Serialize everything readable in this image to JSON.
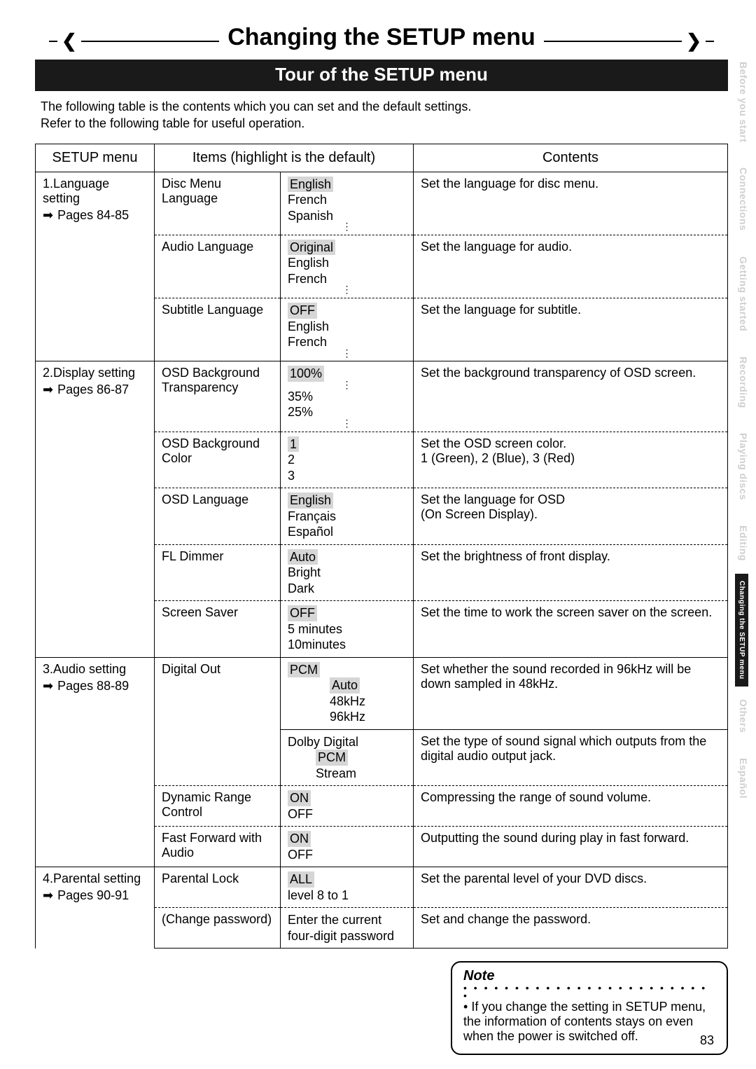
{
  "title": "Changing the SETUP menu",
  "subtitle": "Tour of the SETUP menu",
  "intro1": "The following table is the contents which you can set and the default settings.",
  "intro2": "Refer to the following table for useful operation.",
  "headers": {
    "menu": "SETUP menu",
    "items": "Items (highlight is the default)",
    "contents": "Contents"
  },
  "sections": [
    {
      "label": "1.Language setting",
      "pages": "Pages 84-85"
    },
    {
      "label": "2.Display setting",
      "pages": "Pages 86-87"
    },
    {
      "label": "3.Audio setting",
      "pages": "Pages 88-89"
    },
    {
      "label": "4.Parental setting",
      "pages": "Pages 90-91"
    }
  ],
  "rows": {
    "disc_menu_lang": {
      "item": "Disc Menu Language",
      "opts": [
        "English",
        "French",
        "Spanish"
      ],
      "desc": "Set the language for disc menu."
    },
    "audio_lang": {
      "item": "Audio Language",
      "opts": [
        "Original",
        "English",
        "French"
      ],
      "desc": "Set the language for audio."
    },
    "sub_lang": {
      "item": "Subtitle Language",
      "opts": [
        "OFF",
        "English",
        "French"
      ],
      "desc": "Set the language for subtitle."
    },
    "osd_trans": {
      "item": "OSD Background Transparency",
      "opts": [
        "100%",
        "35%",
        "25%"
      ],
      "desc": "Set the background transparency of OSD screen."
    },
    "osd_color": {
      "item": "OSD Background Color",
      "opts": [
        "1",
        "2",
        "3"
      ],
      "desc1": "Set the OSD screen color.",
      "desc2": "1 (Green), 2 (Blue), 3 (Red)"
    },
    "osd_lang": {
      "item": "OSD Language",
      "opts": [
        "English",
        "Français",
        "Español"
      ],
      "desc1": "Set the language for OSD",
      "desc2": "(On Screen Display)."
    },
    "fl_dimmer": {
      "item": "FL Dimmer",
      "opts": [
        "Auto",
        "Bright",
        "Dark"
      ],
      "desc": "Set the brightness of front display."
    },
    "screen_saver": {
      "item": "Screen Saver",
      "opts": [
        "OFF",
        "5 minutes",
        "10minutes"
      ],
      "desc": "Set the time to work the screen saver on the screen."
    },
    "digital_out_a": {
      "item": "Digital Out",
      "head": "PCM",
      "opts": [
        "Auto",
        "48kHz",
        "96kHz"
      ],
      "desc": "Set whether the sound recorded in 96kHz will be down sampled in 48kHz."
    },
    "digital_out_b": {
      "head": "Dolby Digital",
      "opts": [
        "PCM",
        "Stream"
      ],
      "desc": "Set the type of sound signal which outputs from the digital audio output jack."
    },
    "drc": {
      "item": "Dynamic Range Control",
      "opts": [
        "ON",
        "OFF"
      ],
      "desc": "Compressing the range of sound volume."
    },
    "ff_audio": {
      "item": "Fast Forward with Audio",
      "opts": [
        "ON",
        "OFF"
      ],
      "desc": "Outputting the sound during play in fast forward."
    },
    "parental": {
      "item": "Parental Lock",
      "opts": [
        "ALL",
        "level 8 to 1"
      ],
      "desc": "Set the parental level of your DVD discs."
    },
    "change_pw": {
      "item": "(Change password)",
      "opt": "Enter the current four-digit password",
      "desc": "Set and change the password."
    }
  },
  "note": {
    "title": "Note",
    "body": "If you change the setting in SETUP menu, the information of contents stays on even when the power is switched off."
  },
  "tabs": [
    "Before you start",
    "Connections",
    "Getting started",
    "Recording",
    "Playing discs",
    "Editing",
    "Changing the SETUP menu",
    "Others",
    "Español"
  ],
  "page_number": "83"
}
